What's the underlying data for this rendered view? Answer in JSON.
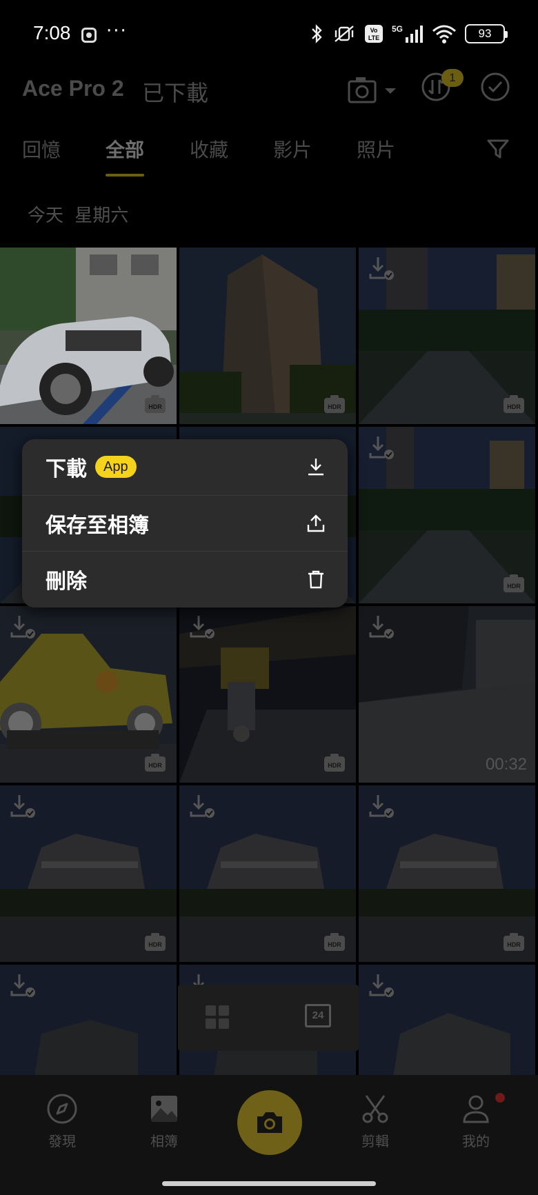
{
  "status_bar": {
    "time": "7:08",
    "dots": "···",
    "network": "5G",
    "volte": "Vo LTE",
    "battery": "93"
  },
  "header": {
    "device_title": "Ace Pro 2",
    "subtitle": "已下載",
    "badge_count": "1"
  },
  "tabs": [
    {
      "label": "回憶"
    },
    {
      "label": "全部",
      "selected": true
    },
    {
      "label": "收藏"
    },
    {
      "label": "影片"
    },
    {
      "label": "照片"
    }
  ],
  "date_label": "今天 星期六",
  "thumbs": [
    {
      "hdr": "HDR"
    },
    {
      "hdr": "HDR"
    },
    {
      "hdr": "HDR"
    },
    {
      "hdr": "HDR"
    },
    {
      "hdr": "HDR"
    },
    {
      "duration": "00:32"
    },
    {
      "hdr": "HDR"
    },
    {
      "hdr": "HDR"
    },
    {
      "hdr": "HDR"
    }
  ],
  "view_switch": {
    "calendar_day": "24"
  },
  "context_menu": {
    "download_label": "下載",
    "app_pill": "App",
    "save_label": "保存至相簿",
    "delete_label": "刪除"
  },
  "bottom_nav": {
    "discover": "發現",
    "album": "相簿",
    "edit": "剪輯",
    "me": "我的"
  },
  "colors": {
    "accent": "#f5d31c",
    "menu_bg": "#2c2c2c",
    "background": "#000000"
  }
}
